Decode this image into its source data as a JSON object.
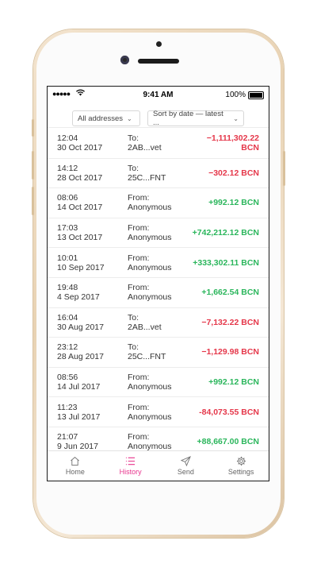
{
  "status_bar": {
    "signal": "●●●●●",
    "time": "9:41 AM",
    "battery": "100%"
  },
  "filters": {
    "address_select": "All addresses",
    "sort_select": "Sort by date — latest ..."
  },
  "transactions": [
    {
      "time": "12:04",
      "date": "30 Oct 2017",
      "direction": "To:",
      "party": "2AB...vet",
      "amount": "−1,111,302.22 BCN",
      "sign": "neg"
    },
    {
      "time": "14:12",
      "date": "28 Oct 2017",
      "direction": "To:",
      "party": "25C...FNT",
      "amount": "−302.12 BCN",
      "sign": "neg"
    },
    {
      "time": "08:06",
      "date": "14 Oct 2017",
      "direction": "From:",
      "party": "Anonymous",
      "amount": "+992.12 BCN",
      "sign": "pos"
    },
    {
      "time": "17:03",
      "date": "13 Oct 2017",
      "direction": "From:",
      "party": "Anonymous",
      "amount": "+742,212.12 BCN",
      "sign": "pos"
    },
    {
      "time": "10:01",
      "date": "10 Sep 2017",
      "direction": "From:",
      "party": "Anonymous",
      "amount": "+333,302.11 BCN",
      "sign": "pos"
    },
    {
      "time": "19:48",
      "date": "4 Sep 2017",
      "direction": "From:",
      "party": "Anonymous",
      "amount": "+1,662.54 BCN",
      "sign": "pos"
    },
    {
      "time": "16:04",
      "date": "30 Aug 2017",
      "direction": "To:",
      "party": "2AB...vet",
      "amount": "−7,132.22 BCN",
      "sign": "neg"
    },
    {
      "time": "23:12",
      "date": "28 Aug 2017",
      "direction": "To:",
      "party": "25C...FNT",
      "amount": "−1,129.98 BCN",
      "sign": "neg"
    },
    {
      "time": "08:56",
      "date": "14 Jul 2017",
      "direction": "From:",
      "party": "Anonymous",
      "amount": "+992.12 BCN",
      "sign": "pos"
    },
    {
      "time": "11:23",
      "date": "13 Jul 2017",
      "direction": "From:",
      "party": "Anonymous",
      "amount": "-84,073.55 BCN",
      "sign": "neg"
    },
    {
      "time": "21:07",
      "date": "9 Jun 2017",
      "direction": "From:",
      "party": "Anonymous",
      "amount": "+88,667.00 BCN",
      "sign": "pos"
    }
  ],
  "tabs": [
    {
      "label": "Home",
      "icon": "home-icon",
      "active": false
    },
    {
      "label": "History",
      "icon": "list-icon",
      "active": true
    },
    {
      "label": "Send",
      "icon": "send-icon",
      "active": false
    },
    {
      "label": "Settings",
      "icon": "gear-icon",
      "active": false
    }
  ],
  "colors": {
    "accent": "#e8348d",
    "negative": "#e5374a",
    "positive": "#2bb65c"
  }
}
